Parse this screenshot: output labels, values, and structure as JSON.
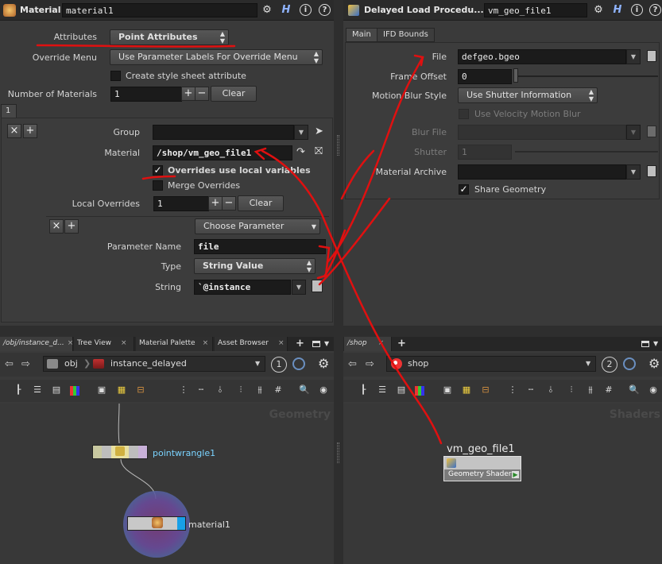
{
  "left_params": {
    "header": {
      "type_label": "Material",
      "node_name": "material1"
    },
    "attributes_label": "Attributes",
    "attributes_value": "Point Attributes",
    "override_menu_label": "Override Menu",
    "override_menu_value": "Use Parameter Labels For Override Menu",
    "create_style_sheet_label": "Create style sheet attribute",
    "num_materials_label": "Number of Materials",
    "num_materials_value": "1",
    "clear_label": "Clear",
    "multiparm_tab": "1",
    "group_label": "Group",
    "group_value": "",
    "material_label": "Material",
    "material_value": "/shop/vm_geo_file1",
    "overrides_local_label": "Overrides use local variables",
    "merge_overrides_label": "Merge Overrides",
    "local_overrides_label": "Local Overrides",
    "local_overrides_value": "1",
    "local_clear_label": "Clear",
    "choose_parameter_label": "Choose Parameter",
    "param_name_label": "Parameter Name",
    "param_name_value": "file",
    "type_label": "Type",
    "type_value": "String Value",
    "string_label": "String",
    "string_value": "`@instance"
  },
  "right_params": {
    "header": {
      "type_label": "Delayed Load Procedu...",
      "node_name": "vm_geo_file1"
    },
    "tabs": [
      "Main",
      "IFD Bounds"
    ],
    "file_label": "File",
    "file_value": "defgeo.bgeo",
    "frame_offset_label": "Frame Offset",
    "frame_offset_value": "0",
    "motion_blur_style_label": "Motion Blur Style",
    "motion_blur_style_value": "Use Shutter Information",
    "use_velocity_label": "Use Velocity Motion Blur",
    "blur_file_label": "Blur File",
    "shutter_label": "Shutter",
    "shutter_value": "1",
    "material_archive_label": "Material Archive",
    "share_geometry_label": "Share Geometry"
  },
  "left_network": {
    "tabs": [
      {
        "label": "/obj/instance_d...",
        "close": "×"
      },
      {
        "label": "Tree View",
        "close": "×"
      },
      {
        "label": "Material Palette",
        "close": "×"
      },
      {
        "label": "Asset Browser",
        "close": "×"
      }
    ],
    "add_tab": "+",
    "path_root": "obj",
    "path_node": "instance_delayed",
    "pin_number": "1",
    "watermark": "Geometry",
    "nodes": {
      "wrangle": "pointwrangle1",
      "material": "material1"
    }
  },
  "right_network": {
    "tabs": [
      {
        "label": "/shop",
        "close": "×"
      }
    ],
    "add_tab": "+",
    "path_node": "shop",
    "pin_number": "2",
    "watermark": "Shaders",
    "shader_node": {
      "name": "vm_geo_file1",
      "subtitle": "Geometry Shader"
    }
  },
  "icons": {
    "gear": "⚙",
    "help": "?",
    "info": "i",
    "h": "H",
    "close": "×",
    "add": "+",
    "minus": "−",
    "arrow_left": "◀",
    "arrow_right": "▶"
  },
  "colors": {
    "annotation_red": "#e01010",
    "node_selected_blue": "#4aa8ff",
    "highlight_ring": "#6b4f8e"
  }
}
